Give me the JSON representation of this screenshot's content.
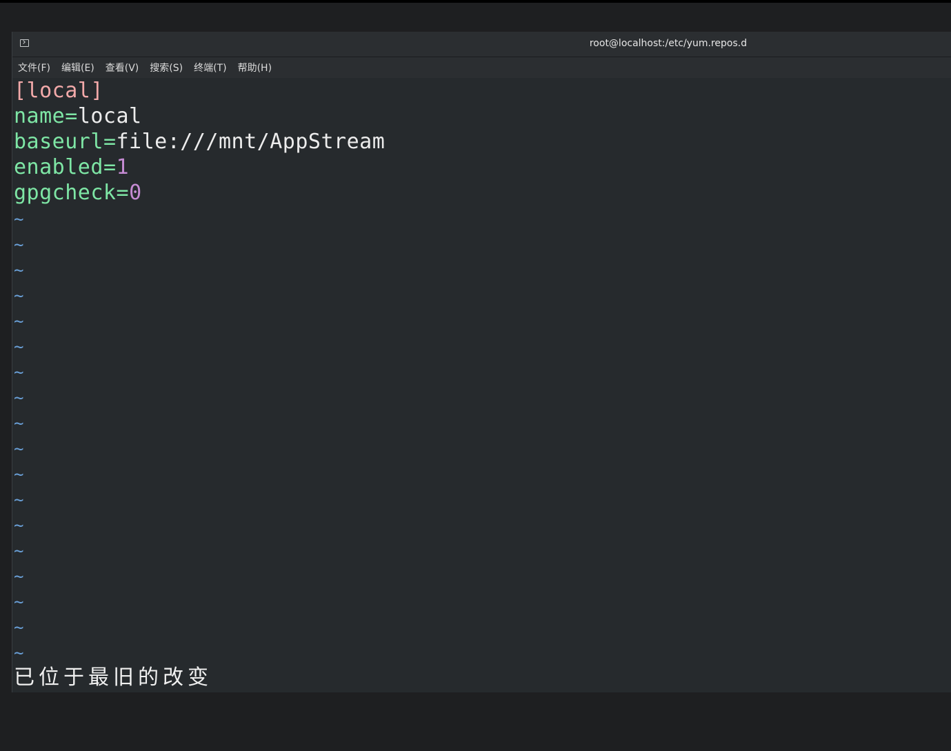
{
  "window": {
    "title": "root@localhost:/etc/yum.repos.d"
  },
  "menu": [
    {
      "label": "文件(F)"
    },
    {
      "label": "编辑(E)"
    },
    {
      "label": "查看(V)"
    },
    {
      "label": "搜索(S)"
    },
    {
      "label": "终端(T)"
    },
    {
      "label": "帮助(H)"
    }
  ],
  "editor": {
    "lines": [
      {
        "section": "[local]"
      },
      {
        "key": "name",
        "eq": "=",
        "value": "local"
      },
      {
        "key": "baseurl",
        "eq": "=",
        "value": "file:///mnt/AppStream"
      },
      {
        "key": "enabled",
        "eq": "=",
        "num": "1"
      },
      {
        "key": "gpgcheck",
        "eq": "=",
        "num": "0"
      }
    ],
    "tilde": "~",
    "status": "已位于最旧的改变"
  },
  "colors": {
    "background": "#262a2d",
    "section": "#f2a9a9",
    "key": "#7ee6a5",
    "number": "#c58bd3",
    "tilde": "#6aa0d8"
  }
}
